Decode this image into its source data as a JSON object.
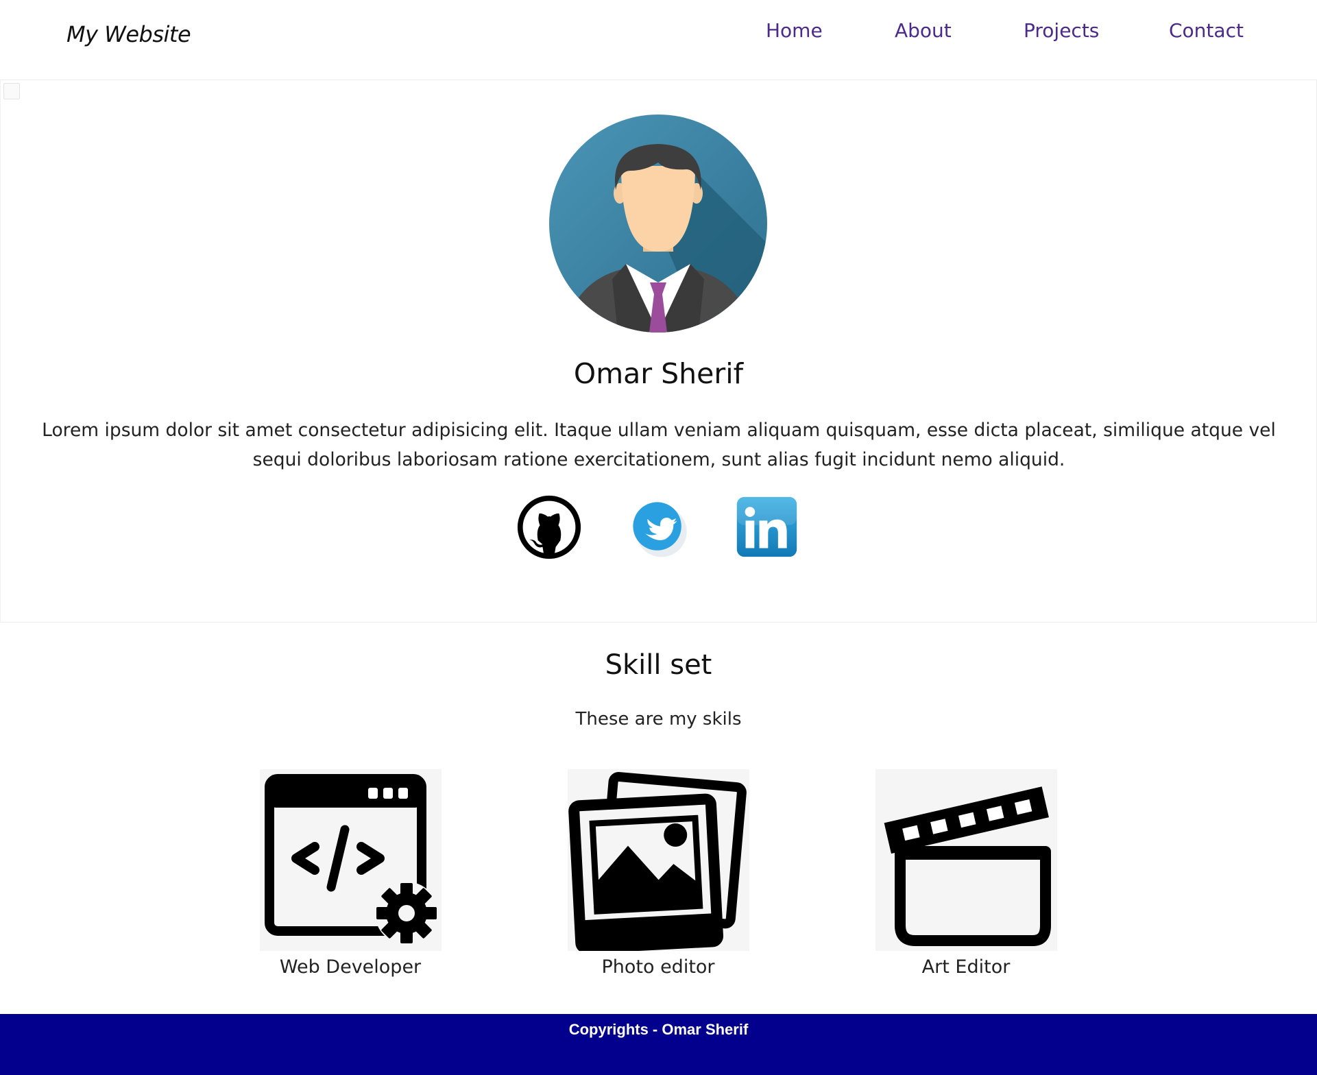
{
  "header": {
    "brand": "My Website",
    "nav": [
      {
        "label": "Home"
      },
      {
        "label": "About"
      },
      {
        "label": "Projects"
      },
      {
        "label": "Contact"
      }
    ]
  },
  "hero": {
    "name": "Omar Sherif",
    "bio": "Lorem ipsum dolor sit amet consectetur adipisicing elit. Itaque ullam veniam aliquam quisquam, esse dicta placeat, similique atque vel sequi doloribus laboriosam ratione exercitationem, sunt alias fugit incidunt nemo aliquid.",
    "social": [
      {
        "icon": "github-icon"
      },
      {
        "icon": "twitter-icon"
      },
      {
        "icon": "linkedin-icon"
      }
    ]
  },
  "skills": {
    "title": "Skill set",
    "subtitle": "These are my skils",
    "items": [
      {
        "label": "Web Developer",
        "icon": "code-window-gear-icon"
      },
      {
        "label": "Photo editor",
        "icon": "photos-icon"
      },
      {
        "label": "Art Editor",
        "icon": "clapperboard-icon"
      }
    ]
  },
  "footer": {
    "text": "Copyrights - Omar Sherif"
  },
  "colors": {
    "nav_link": "#4b2a8c",
    "footer_bg": "#03008d",
    "twitter": "#2ba0e0",
    "linkedin": "#1d87c5",
    "avatar_bg": "#3f87a8",
    "tie": "#9b4d9b"
  }
}
